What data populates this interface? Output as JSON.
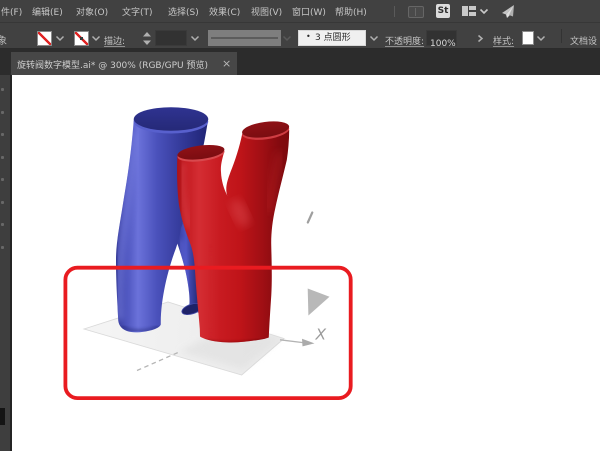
{
  "menubar": {
    "items": [
      "件(F)",
      "编辑(E)",
      "对象(O)",
      "文字(T)",
      "选择(S)",
      "效果(C)",
      "视图(V)",
      "窗口(W)",
      "帮助(H)"
    ],
    "stock_badge": "St",
    "icons": [
      "arrange-documents-icon",
      "adobe-stock-icon",
      "workspace-switcher-icon",
      "chevron-down-icon",
      "share-icon"
    ]
  },
  "controlbar": {
    "selection_fragment": "象",
    "stroke_label": "描边:",
    "brush_bullet": "•",
    "brush_name": "3 点圆形",
    "opacity_label": "不透明度:",
    "opacity_value": "100%",
    "style_label": "样式:",
    "document_setup_label": "文档设",
    "icons": [
      "fill-none-swatch",
      "stroke-none-swatch",
      "stroke-weight-stepper",
      "width-profile-preview",
      "style-swatch"
    ]
  },
  "tabbar": {
    "title": "旋转阀数字模型.ai* @ 300% (RGB/GPU 预览)",
    "close_glyph": "×"
  },
  "canvas": {
    "axis_label": "X"
  },
  "colors": {
    "ui_bar": "#414141",
    "ui_tabbar": "#2c2c2c",
    "ui_text": "#c6c6c6",
    "annotation_red": "#e91b20",
    "tube_blue": "#3c43b2",
    "tube_red": "#c1171c",
    "swatch_none_red": "#e02424",
    "ground_gray": "#ededed"
  }
}
